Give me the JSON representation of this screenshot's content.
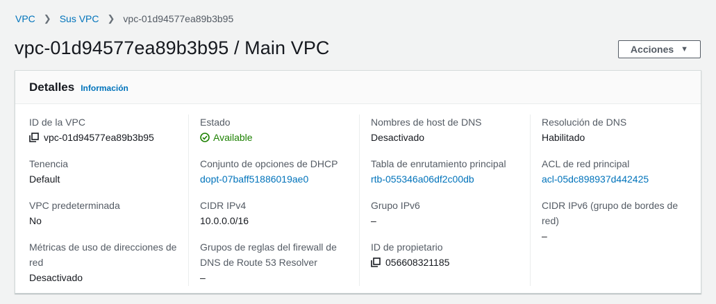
{
  "breadcrumb": {
    "items": [
      {
        "label": "VPC"
      },
      {
        "label": "Sus VPC"
      },
      {
        "label": "vpc-01d94577ea89b3b95"
      }
    ]
  },
  "page": {
    "title": "vpc-01d94577ea89b3b95 / Main VPC",
    "actions_label": "Acciones"
  },
  "details": {
    "title": "Detalles",
    "info_label": "Información",
    "vpc_id": {
      "label": "ID de la VPC",
      "value": "vpc-01d94577ea89b3b95"
    },
    "state": {
      "label": "Estado",
      "value": "Available"
    },
    "dns_hostnames": {
      "label": "Nombres de host de DNS",
      "value": "Desactivado"
    },
    "dns_resolution": {
      "label": "Resolución de DNS",
      "value": "Habilitado"
    },
    "tenancy": {
      "label": "Tenencia",
      "value": "Default"
    },
    "dhcp_options": {
      "label": "Conjunto de opciones de DHCP",
      "value": "dopt-07baff51886019ae0"
    },
    "main_route_table": {
      "label": "Tabla de enrutamiento principal",
      "value": "rtb-055346a06df2c00db"
    },
    "main_network_acl": {
      "label": "ACL de red principal",
      "value": "acl-05dc898937d442425"
    },
    "default_vpc": {
      "label": "VPC predeterminada",
      "value": "No"
    },
    "ipv4_cidr": {
      "label": "CIDR IPv4",
      "value": "10.0.0.0/16"
    },
    "ipv6_pool": {
      "label": "Grupo IPv6",
      "value": "–"
    },
    "ipv6_cidr": {
      "label": "CIDR IPv6 (grupo de bordes de red)",
      "value": "–"
    },
    "network_address_metrics": {
      "label": "Métricas de uso de direcciones de red",
      "value": "Desactivado"
    },
    "route53_firewall": {
      "label": "Grupos de reglas del firewall de DNS de Route 53 Resolver",
      "value": "–"
    },
    "owner_id": {
      "label": "ID de propietario",
      "value": "056608321185"
    }
  },
  "colors": {
    "link": "#0073bb",
    "success": "#1d8102",
    "text": "#16191f",
    "label": "#545b64",
    "background": "#f2f3f3"
  },
  "icons": [
    "chevron-right-icon",
    "caret-down-icon",
    "copy-icon",
    "status-ok-icon"
  ]
}
